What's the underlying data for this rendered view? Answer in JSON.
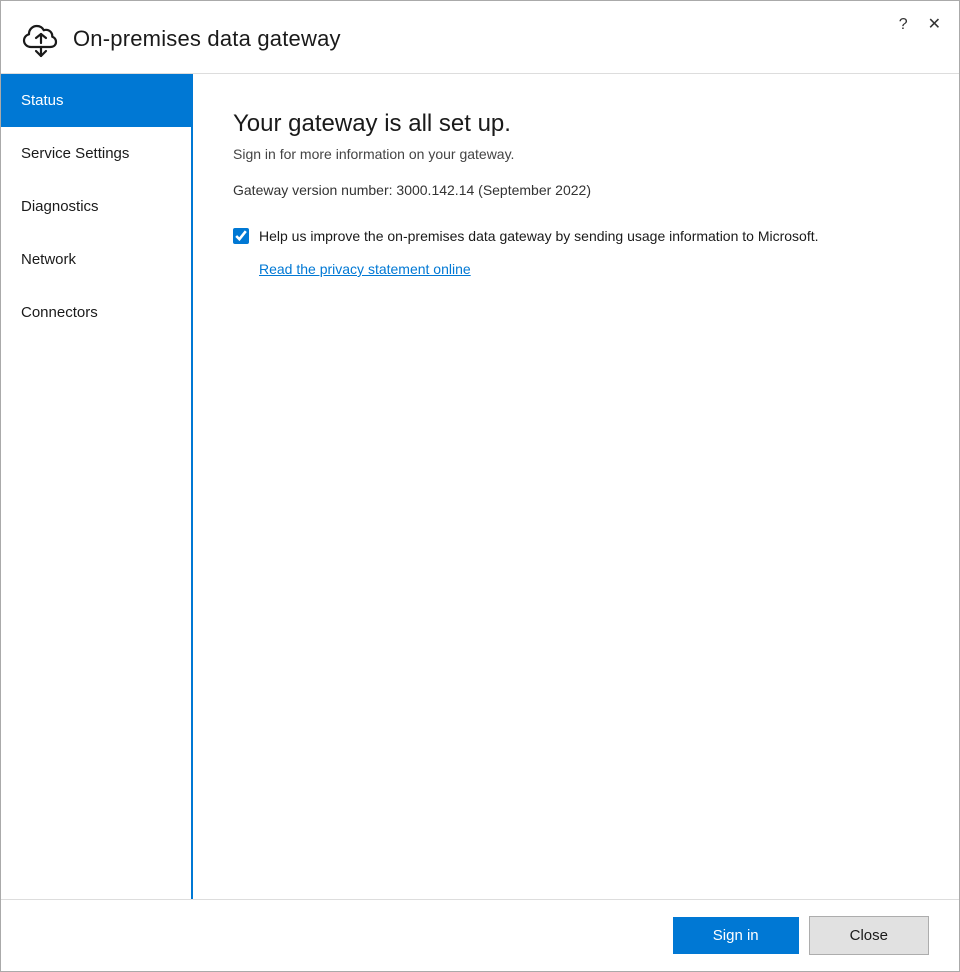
{
  "window": {
    "title": "On-premises data gateway"
  },
  "titlebar": {
    "help_label": "?",
    "close_label": "✕"
  },
  "sidebar": {
    "items": [
      {
        "id": "status",
        "label": "Status",
        "active": true
      },
      {
        "id": "service-settings",
        "label": "Service Settings",
        "active": false
      },
      {
        "id": "diagnostics",
        "label": "Diagnostics",
        "active": false
      },
      {
        "id": "network",
        "label": "Network",
        "active": false
      },
      {
        "id": "connectors",
        "label": "Connectors",
        "active": false
      }
    ]
  },
  "content": {
    "title": "Your gateway is all set up.",
    "subtitle": "Sign in for more information on your gateway.",
    "version": "Gateway version number: 3000.142.14 (September 2022)",
    "checkbox_label": "Help us improve the on-premises data gateway by sending usage information to Microsoft.",
    "checkbox_checked": true,
    "privacy_link": "Read the privacy statement online"
  },
  "footer": {
    "signin_label": "Sign in",
    "close_label": "Close"
  }
}
